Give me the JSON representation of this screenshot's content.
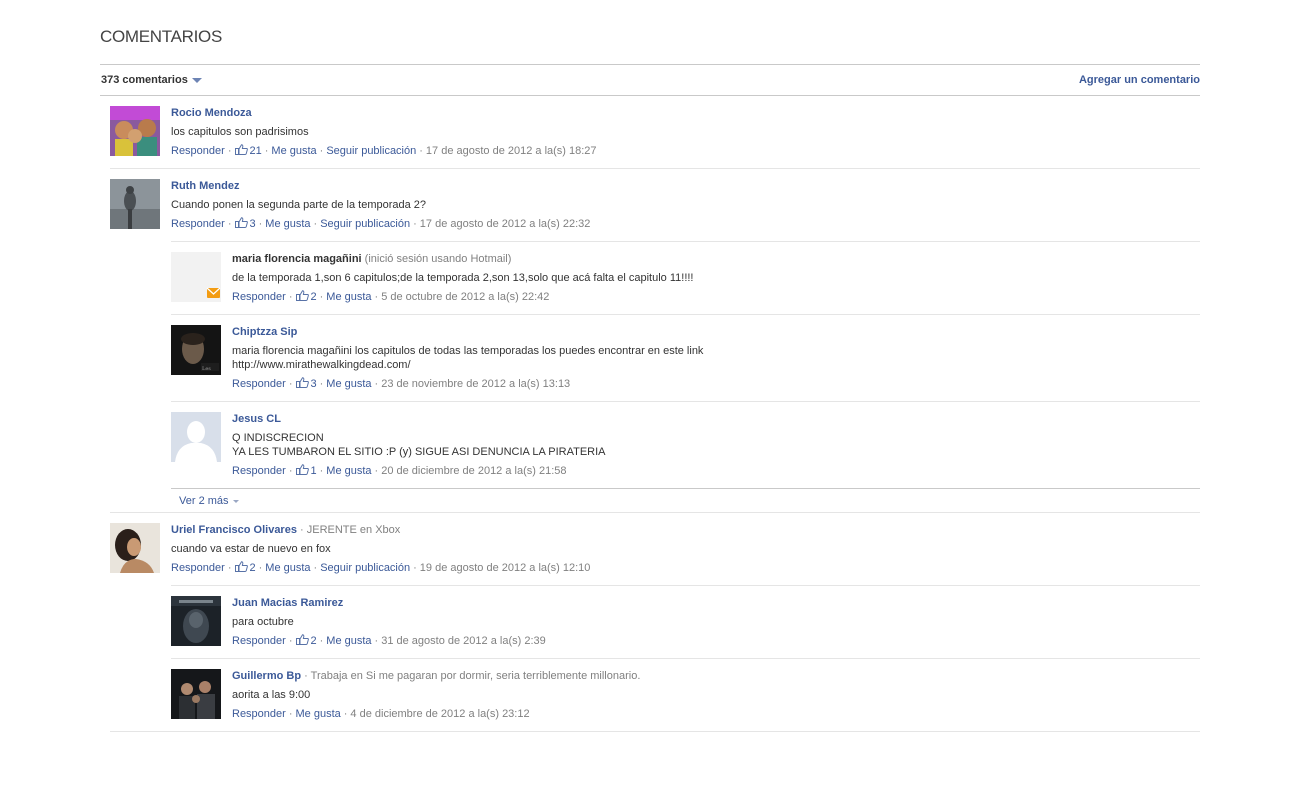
{
  "header": {
    "title": "COMENTARIOS"
  },
  "count_bar": {
    "count_label": "373 comentarios",
    "add_label": "Agregar un comentario"
  },
  "actions": {
    "reply": "Responder",
    "like": "Me gusta",
    "follow": "Seguir publicación"
  },
  "comments": [
    {
      "author": "Rocio Mendoza",
      "author_note": "",
      "text": "los capitulos son padrisimos",
      "likes": "21",
      "timestamp": "17 de agosto de 2012 a la(s) 18:27"
    },
    {
      "author": "Ruth Mendez",
      "author_note": "",
      "text": "Cuando ponen la segunda parte de la temporada 2?",
      "likes": "3",
      "timestamp": "17 de agosto de 2012 a la(s) 22:32",
      "replies": [
        {
          "author": "maria florencia magañini",
          "author_note": "(inició sesión usando Hotmail)",
          "text": "de la temporada 1,son 6 capitulos;de la temporada 2,son 13,solo que acá falta el capitulo 11!!!!",
          "likes": "2",
          "timestamp": "5 de octubre de 2012 a la(s) 22:42"
        },
        {
          "author": "Chiptzza Sip",
          "author_note": "",
          "text": "maria florencia magañini los capitulos de todas las temporadas los puedes encontrar en este link\nhttp://www.mirathewalkingdead.com/",
          "likes": "3",
          "timestamp": "23 de noviembre de 2012 a la(s) 13:13"
        },
        {
          "author": "Jesus CL",
          "author_note": "",
          "text": "Q INDISCRECION\nYA LES TUMBARON EL SITIO :P (y) SIGUE ASI DENUNCIA LA PIRATERIA",
          "likes": "1",
          "timestamp": "20 de diciembre de 2012 a la(s) 21:58"
        }
      ],
      "more_label": "Ver 2 más"
    },
    {
      "author": "Uriel Francisco Olivares",
      "author_note": "· JERENTE en Xbox",
      "text": "cuando va estar de nuevo en fox",
      "likes": "2",
      "timestamp": "19 de agosto de 2012 a la(s) 12:10",
      "replies": [
        {
          "author": "Juan Macias Ramirez",
          "author_note": "",
          "text": "para octubre",
          "likes": "2",
          "timestamp": "31 de agosto de 2012 a la(s) 2:39"
        },
        {
          "author": "Guillermo Bp",
          "author_note": "· Trabaja en Si me pagaran por dormir, seria terriblemente millonario.",
          "text": "aorita a las 9:00",
          "likes": "",
          "timestamp": "4 de diciembre de 2012 a la(s) 23:12"
        }
      ]
    }
  ],
  "colors": {
    "link": "#3b5998",
    "muted": "#808080",
    "text": "#333333",
    "rule": "#c9c9c9",
    "separator": "#e5e5e5"
  },
  "icons": {
    "like": "thumbs-up-icon",
    "caret": "chevron-down-icon",
    "hotmail": "envelope-icon",
    "default_avatar": "silhouette-icon"
  }
}
